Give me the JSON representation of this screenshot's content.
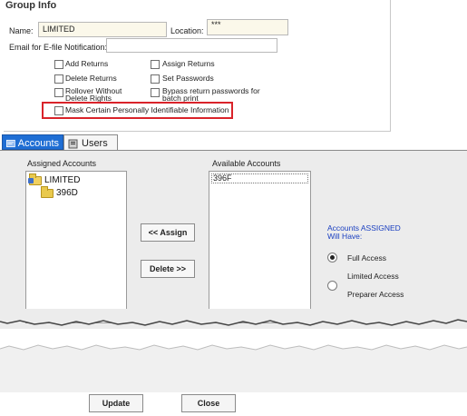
{
  "group_info": {
    "title": "Group Info",
    "name_label": "Name:",
    "name_value": "LIMITED",
    "location_label": "Location:",
    "location_value": "***",
    "email_label": "Email for E-file Notification:",
    "email_value": ""
  },
  "checkboxes": {
    "add_returns": "Add Returns",
    "delete_returns": "Delete Returns",
    "rollover_line1": "Rollover Without",
    "rollover_line2": "Delete Rights",
    "assign_returns": "Assign Returns",
    "set_passwords": "Set Passwords",
    "bypass_line1": "Bypass return passwords for",
    "bypass_line2": "batch print",
    "mask_pii": "Mask Certain Personally Identifiable Information"
  },
  "tabs": {
    "accounts": "Accounts",
    "users": "Users"
  },
  "accounts": {
    "assigned_label": "Assigned Accounts",
    "available_label": "Available Accounts",
    "tree_root": "LIMITED",
    "tree_child": "396D",
    "available_items": [
      "396F"
    ],
    "assign_button": "<< Assign",
    "delete_button": "Delete >>",
    "access_title_line1": "Accounts ASSIGNED",
    "access_title_line2": "Will Have:",
    "full_access": "Full Access",
    "limited_access": "Limited Access",
    "preparer_access": "Preparer Access",
    "selected_access": "Full Access"
  },
  "footer": {
    "update_button": "Update",
    "close_button": "Close"
  },
  "colors": {
    "highlight_border": "#d9232a",
    "active_tab": "#1f6ed4",
    "field_bg": "#fbf8ea",
    "access_title": "#1a3fc0"
  }
}
